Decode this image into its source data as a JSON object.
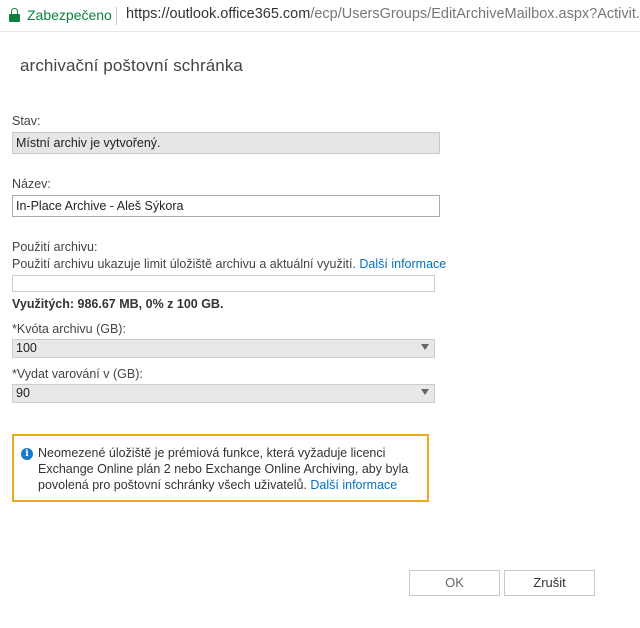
{
  "browser": {
    "secure_label": "Zabezpečeno",
    "url_host": "https://outlook.office365.com",
    "url_path": "/ecp/UsersGroups/EditArchiveMailbox.aspx?Activit..."
  },
  "dialog": {
    "title": "archivační poštovní schránka",
    "status": {
      "label": "Stav:",
      "value": "Místní archiv je vytvořený."
    },
    "name": {
      "label": "Název:",
      "value": "In-Place Archive - Aleš Sýkora"
    },
    "usage": {
      "label": "Použití archivu:",
      "description": "Použití archivu ukazuje limit úložiště archivu a aktuální využití.",
      "more_link": "Další informace",
      "summary": "Využitých: 986.67 MB, 0% z 100 GB.",
      "fraction_used": 0
    },
    "quota": {
      "label": "*Kvóta archivu (GB):",
      "value": "100"
    },
    "warning": {
      "label": "*Vydat varování v (GB):",
      "value": "90"
    },
    "info": {
      "text": "Neomezené úložiště je prémiová funkce, která vyžaduje licenci Exchange Online plán 2 nebo Exchange Online Archiving, aby byla povolená pro poštovní schránky všech uživatelů.",
      "more_link": "Další informace"
    },
    "buttons": {
      "ok": "OK",
      "cancel": "Zrušit"
    }
  },
  "colors": {
    "secure_green": "#0b8043",
    "link_blue": "#0072c6",
    "info_border": "#f0a81e",
    "info_icon": "#1979ca"
  },
  "icons": {
    "lock": "lock-icon",
    "info": "info-icon",
    "dropdown": "chevron-down-icon"
  }
}
